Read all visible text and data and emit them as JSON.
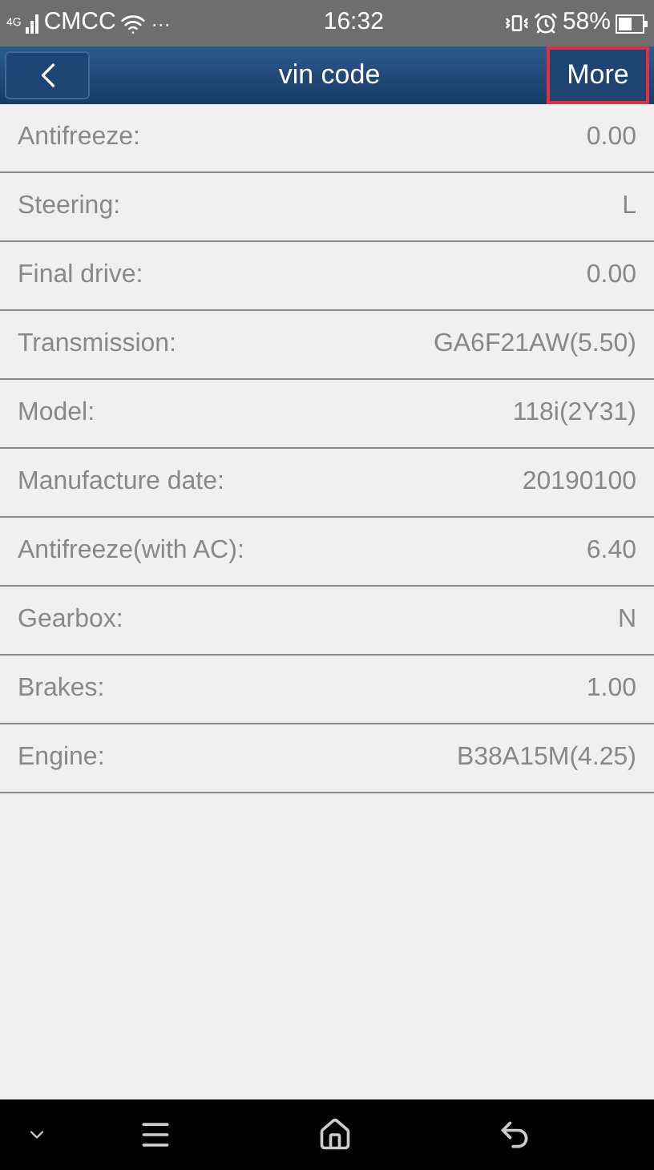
{
  "status_bar": {
    "network": "4G",
    "carrier": "CMCC",
    "more": "···",
    "time": "16:32",
    "battery": "58%"
  },
  "nav_bar": {
    "title": "vin code",
    "action": "More",
    "action_highlighted": true
  },
  "rows": [
    {
      "label": "Antifreeze:",
      "value": "0.00"
    },
    {
      "label": "Steering:",
      "value": "L"
    },
    {
      "label": "Final drive:",
      "value": "0.00"
    },
    {
      "label": "Transmission:",
      "value": "GA6F21AW(5.50)"
    },
    {
      "label": "Model:",
      "value": "118i(2Y31)"
    },
    {
      "label": "Manufacture date:",
      "value": "20190100"
    },
    {
      "label": "Antifreeze(with AC):",
      "value": "6.40"
    },
    {
      "label": "Gearbox:",
      "value": "N"
    },
    {
      "label": "Brakes:",
      "value": "1.00"
    },
    {
      "label": "Engine:",
      "value": "B38A15M(4.25)"
    }
  ]
}
